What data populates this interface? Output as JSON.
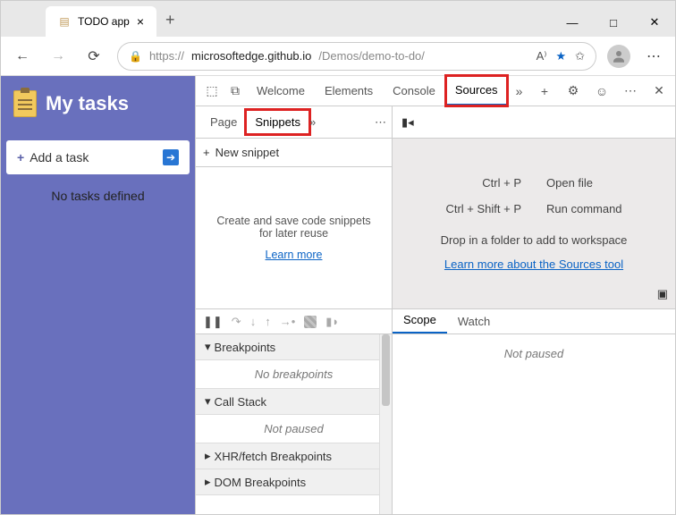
{
  "browser": {
    "tab_title": "TODO app",
    "url_prefix": "https://",
    "url_host": "microsoftedge.github.io",
    "url_path": "/Demos/demo-to-do/"
  },
  "app": {
    "title": "My tasks",
    "add_task_label": "Add a task",
    "empty_label": "No tasks defined"
  },
  "devtools": {
    "tabs": {
      "welcome": "Welcome",
      "elements": "Elements",
      "console": "Console",
      "sources": "Sources"
    },
    "left": {
      "page": "Page",
      "snippets": "Snippets",
      "new_snippet": "New snippet",
      "hint": "Create and save code snippets for later reuse",
      "learn": "Learn more"
    },
    "placeholder": {
      "k1": "Ctrl + P",
      "v1": "Open file",
      "k2": "Ctrl + Shift + P",
      "v2": "Run command",
      "drop": "Drop in a folder to add to workspace",
      "learn": "Learn more about the Sources tool"
    },
    "debugger": {
      "breakpoints": "Breakpoints",
      "no_breakpoints": "No breakpoints",
      "call_stack": "Call Stack",
      "not_paused": "Not paused",
      "xhr": "XHR/fetch Breakpoints",
      "dom": "DOM Breakpoints"
    },
    "scope": {
      "scope": "Scope",
      "watch": "Watch",
      "not_paused": "Not paused"
    }
  }
}
